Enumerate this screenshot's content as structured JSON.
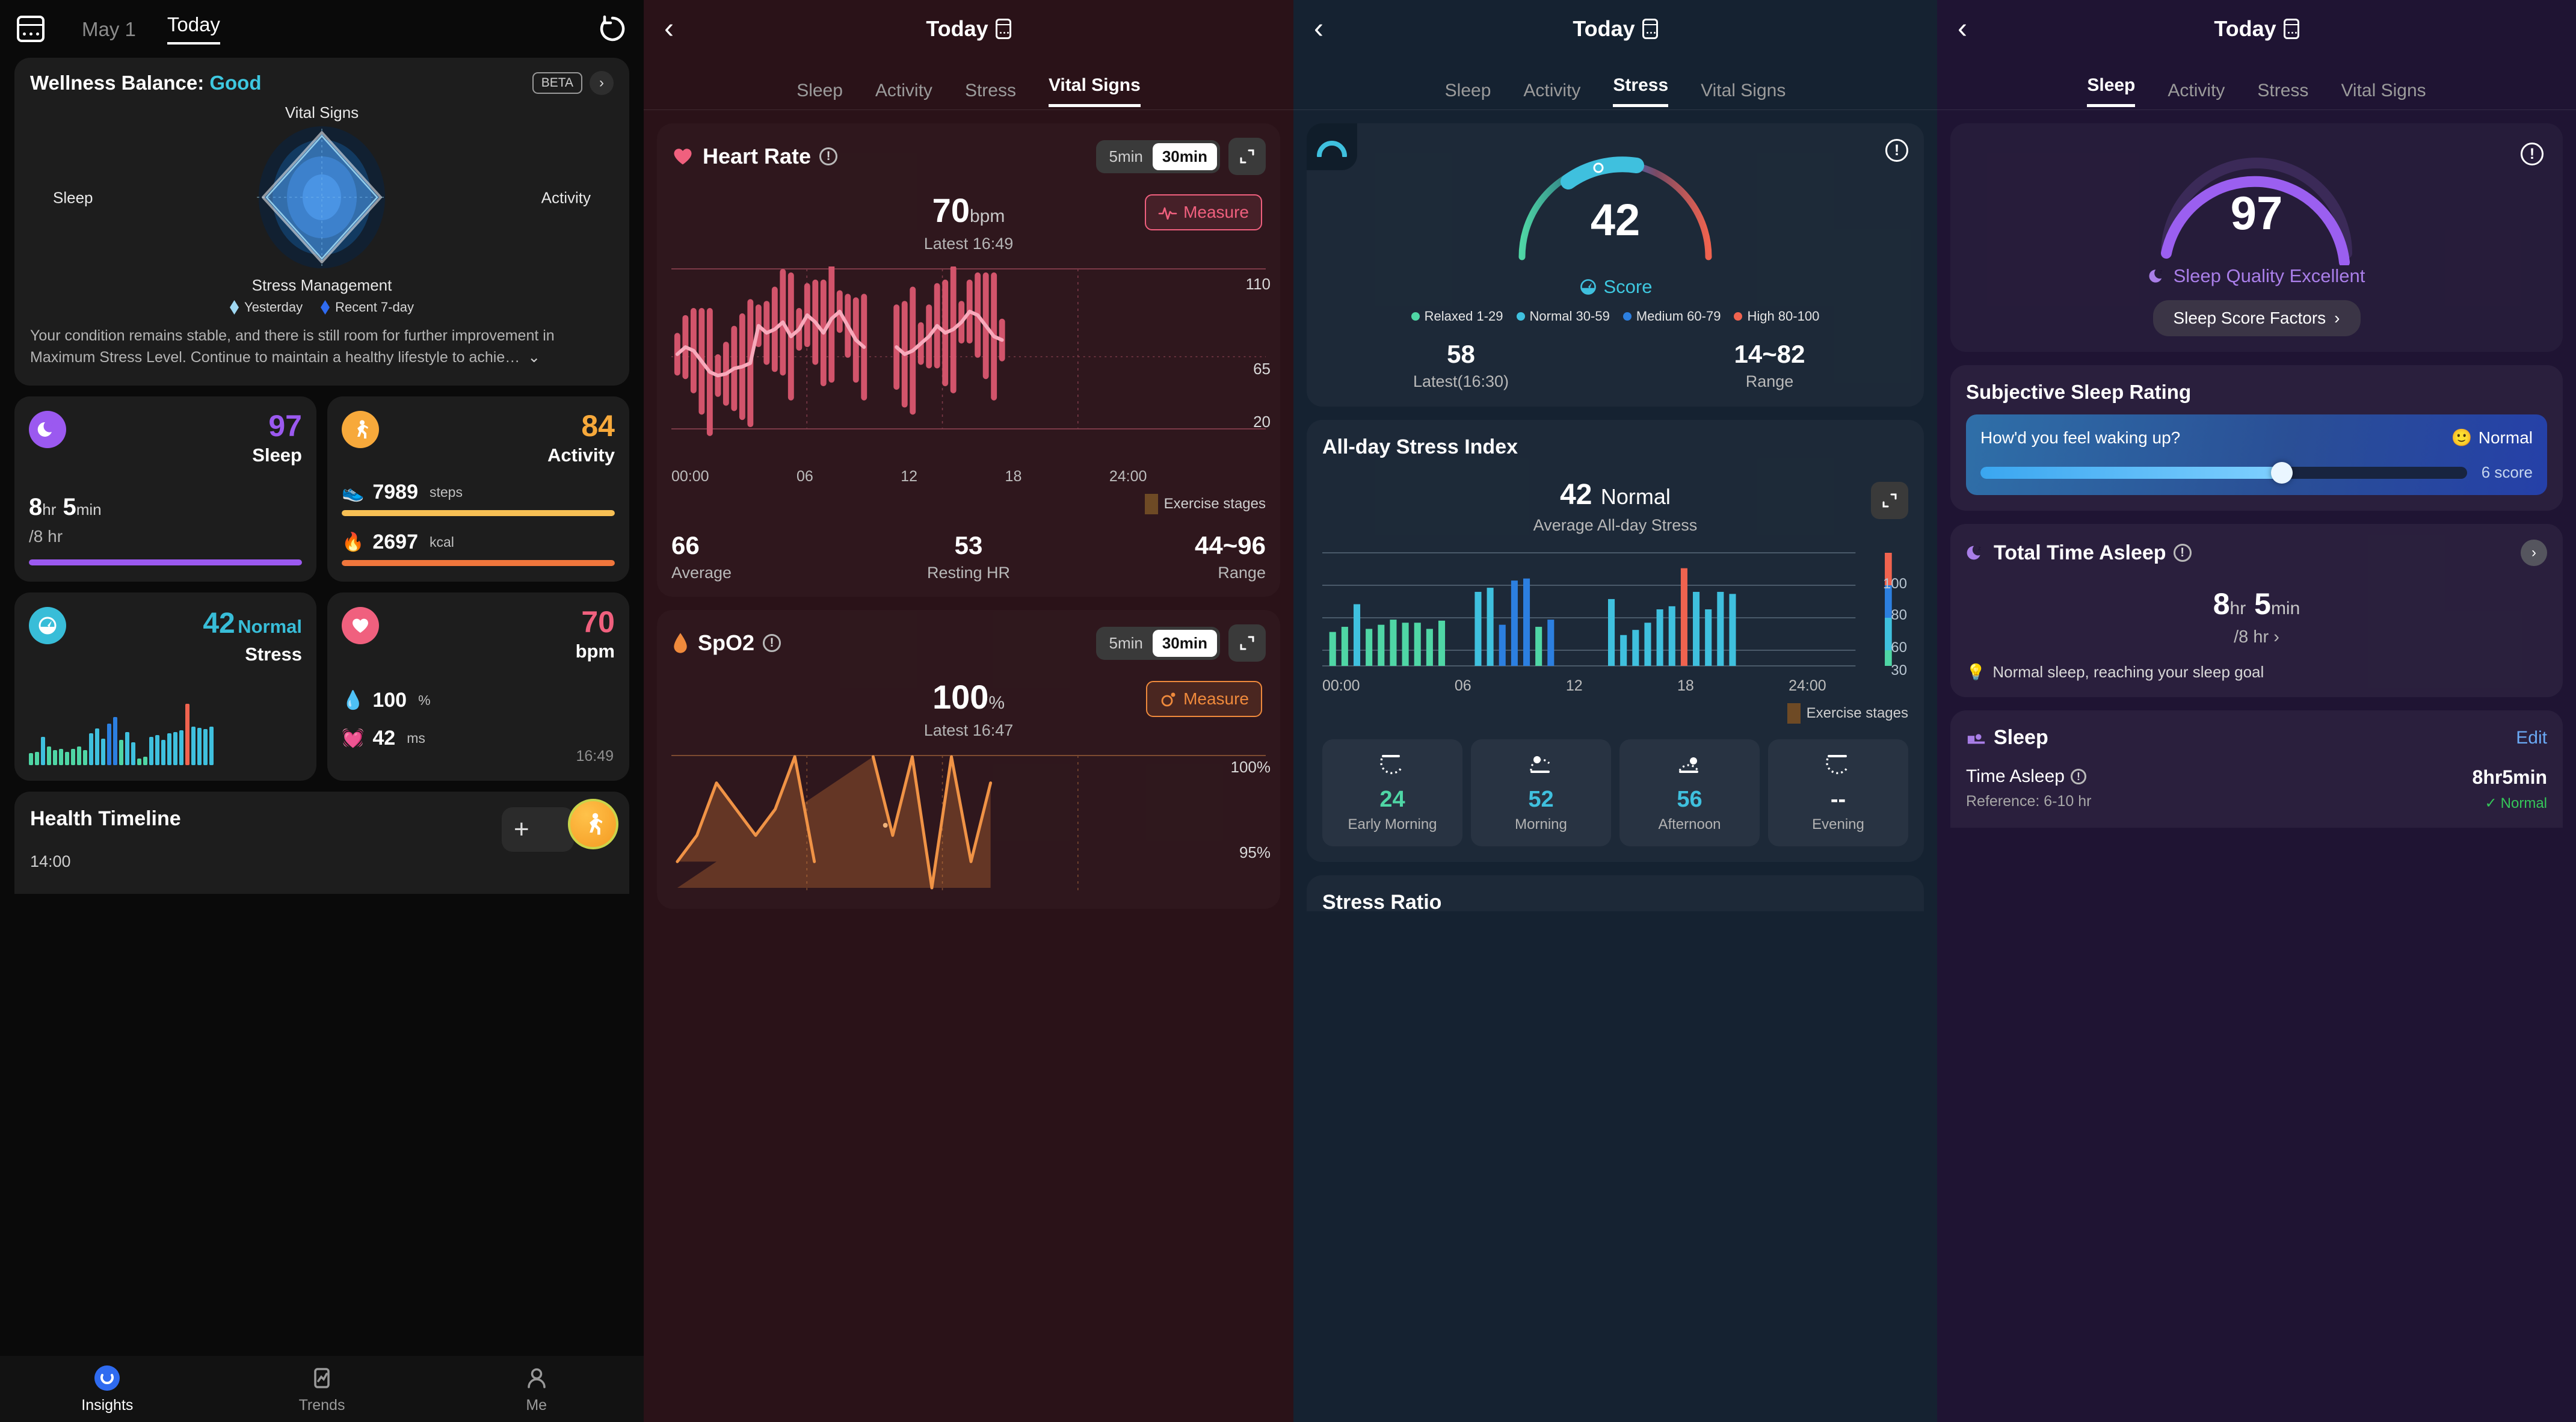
{
  "insights": {
    "header": {
      "calendar_icon": "calendar-icon",
      "date_prev": "May 1",
      "date_today": "Today",
      "refresh_icon": "refresh-icon"
    },
    "wellness": {
      "title_prefix": "Wellness Balance:",
      "status": "Good",
      "beta_badge": "BETA",
      "chevron": "›",
      "axes": {
        "top": "Vital Signs",
        "right": "Activity",
        "bottom": "Stress Management",
        "left": "Sleep"
      },
      "legend": [
        {
          "label": "Yesterday",
          "color": "#9fd8f2"
        },
        {
          "label": "Recent 7-day",
          "color": "#2f6bf0"
        }
      ],
      "description": "Your condition remains stable, and there is still room for further improvement in Maximum Stress Level. Continue to maintain a healthy lifestyle to achie…"
    },
    "cards": {
      "sleep": {
        "icon": "sleep-moon-icon",
        "score": "97",
        "label": "Sleep",
        "duration_h": "8",
        "unit_h": "hr",
        "duration_m": "5",
        "unit_m": "min",
        "goal": "/8 hr",
        "color": "#9b59f0",
        "progress": 100
      },
      "activity": {
        "icon": "running-icon",
        "score": "84",
        "label": "Activity",
        "color": "#f7a93b",
        "steps_value": "7989",
        "steps_unit": "steps",
        "steps_progress": 100,
        "kcal_value": "2697",
        "kcal_unit": "kcal",
        "kcal_progress": 100,
        "steps_icon": "shoe-icon",
        "kcal_icon": "flame-icon"
      },
      "stress": {
        "icon": "stress-gauge-icon",
        "score": "42",
        "status": "Normal",
        "label": "Stress",
        "color": "#38bdd8"
      },
      "heartrate": {
        "icon": "heart-icon",
        "value": "70",
        "unit": "bpm",
        "color": "#f0607e",
        "spo2_value": "100",
        "spo2_unit": "%",
        "spo2_icon": "drop-icon",
        "hrv_value": "42",
        "hrv_unit": "ms",
        "hrv_icon": "heart-pulse-icon",
        "time": "16:49"
      }
    },
    "timeline": {
      "title": "Health Timeline",
      "time": "14:00",
      "add_icon": "plus-icon",
      "fab_icon": "running-fab-icon"
    },
    "tabbar": [
      {
        "label": "Insights",
        "icon": "insights-ring-icon",
        "active": true
      },
      {
        "label": "Trends",
        "icon": "trends-chart-icon",
        "active": false
      },
      {
        "label": "Me",
        "icon": "person-icon",
        "active": false
      }
    ]
  },
  "vitalsigns": {
    "header": {
      "back": "‹",
      "title": "Today",
      "phone_icon": "phone-icon"
    },
    "tabs": [
      "Sleep",
      "Activity",
      "Stress",
      "Vital Signs"
    ],
    "active_tab": "Vital Signs",
    "heart_rate": {
      "title": "Heart Rate",
      "info_icon": "info-icon",
      "seg": [
        "5min",
        "30min"
      ],
      "seg_active": "30min",
      "expand_icon": "expand-icon",
      "value": "70",
      "unit": "bpm",
      "latest": "Latest 16:49",
      "measure_label": "Measure",
      "measure_icon": "ecg-icon",
      "legend": "Exercise stages",
      "stats": [
        {
          "value": "66",
          "label": "Average"
        },
        {
          "value": "53",
          "label": "Resting HR"
        },
        {
          "value": "44~96",
          "label": "Range"
        }
      ]
    },
    "spo2": {
      "title": "SpO2",
      "info_icon": "info-icon",
      "seg": [
        "5min",
        "30min"
      ],
      "seg_active": "30min",
      "expand_icon": "expand-icon",
      "value": "100",
      "unit": "%",
      "latest": "Latest 16:47",
      "measure_label": "Measure",
      "measure_icon": "spo2-icon"
    }
  },
  "stress": {
    "header": {
      "back": "‹",
      "title": "Today",
      "phone_icon": "phone-icon"
    },
    "tabs": [
      "Sleep",
      "Activity",
      "Stress",
      "Vital Signs"
    ],
    "active_tab": "Stress",
    "gauge": {
      "score": "42",
      "score_label": "Score",
      "score_icon": "stress-gauge-icon",
      "warn_icon": "info-icon",
      "corner_icon": "arc-icon",
      "legend": [
        {
          "label": "Relaxed 1-29",
          "color": "#4fd6a5"
        },
        {
          "label": "Normal 30-59",
          "color": "#3fc0de"
        },
        {
          "label": "Medium 60-79",
          "color": "#2c7fe0"
        },
        {
          "label": "High 80-100",
          "color": "#f0634f"
        }
      ],
      "stats": [
        {
          "value": "58",
          "label": "Latest(16:30)"
        },
        {
          "value": "14~82",
          "label": "Range"
        }
      ]
    },
    "allday": {
      "title": "All-day Stress Index",
      "avg_value": "42",
      "avg_status": "Normal",
      "avg_label": "Average All-day Stress",
      "expand_icon": "expand-icon",
      "legend": "Exercise stages"
    },
    "time_of_day": [
      {
        "icon": "early-morning-icon",
        "value": "24",
        "label": "Early Morning",
        "color": "#4fd6a5"
      },
      {
        "icon": "morning-icon",
        "value": "52",
        "label": "Morning",
        "color": "#3fc0de"
      },
      {
        "icon": "afternoon-icon",
        "value": "56",
        "label": "Afternoon",
        "color": "#3fc0de"
      },
      {
        "icon": "evening-icon",
        "value": "--",
        "label": "Evening",
        "color": "#ffffff"
      }
    ],
    "next_section_title": "Stress Ratio"
  },
  "sleep": {
    "header": {
      "back": "‹",
      "title": "Today",
      "phone_icon": "phone-icon"
    },
    "tabs": [
      "Sleep",
      "Activity",
      "Stress",
      "Vital Signs"
    ],
    "active_tab": "Sleep",
    "score": {
      "value": "97",
      "quality_label": "Sleep Quality Excellent",
      "quality_icon": "sleep-moon-icon",
      "warn_icon": "info-icon",
      "factors_button": "Sleep Score Factors",
      "factors_chevron": "›"
    },
    "subjective": {
      "title": "Subjective Sleep Rating",
      "question": "How'd you feel waking up?",
      "mood_emoji": "🙂",
      "mood_label": "Normal",
      "score_text": "6 score",
      "slider_percent": 62
    },
    "total_time": {
      "title": "Total Time Asleep",
      "info_icon": "info-icon",
      "chevron": "›",
      "hours": "8",
      "hours_unit": "hr",
      "minutes": "5",
      "minutes_unit": "min",
      "goal": "/8 hr",
      "goal_chevron": "›",
      "note_icon": "bulb-icon",
      "note": "Normal sleep, reaching your sleep goal"
    },
    "sleep_section": {
      "title": "Sleep",
      "icon": "sleep-bed-icon",
      "edit": "Edit",
      "row_key": "Time Asleep",
      "row_info_icon": "info-icon",
      "row_value": "8hr5min",
      "row_ref": "Reference: 6-10 hr",
      "row_badge": "Normal",
      "row_badge_icon": "check-icon"
    }
  },
  "chart_data": [
    {
      "type": "line",
      "title": "Heart Rate",
      "xlabel": "",
      "ylabel": "bpm",
      "ylim": [
        20,
        110
      ],
      "yticks": [
        110,
        65,
        20
      ],
      "xticks": [
        "00:00",
        "06",
        "12",
        "18",
        "24:00"
      ],
      "series": [
        {
          "name": "Heart Rate",
          "values": [
            62,
            66,
            64,
            58,
            52,
            50,
            51,
            54,
            55,
            57,
            78,
            74,
            76,
            80,
            72,
            76,
            84,
            80,
            74,
            82,
            86,
            78,
            70,
            66,
            null,
            null,
            null,
            66,
            62,
            64,
            68,
            72,
            78,
            74,
            76,
            80,
            86,
            84,
            78,
            72,
            70
          ]
        }
      ],
      "range_band": {
        "low": 44,
        "high": 96
      }
    },
    {
      "type": "line",
      "title": "SpO2",
      "xlabel": "",
      "ylabel": "%",
      "ylim": [
        95,
        100
      ],
      "yticks": [
        "100%",
        "95%"
      ],
      "series": [
        {
          "name": "SpO2",
          "values": [
            96,
            97,
            99,
            98,
            97,
            98,
            100,
            96,
            null,
            null,
            100,
            97,
            100,
            95,
            100,
            96,
            99
          ]
        }
      ]
    },
    {
      "type": "bar",
      "title": "All-day Stress Index",
      "xlabel": "",
      "ylabel": "Stress",
      "ylim": [
        0,
        110
      ],
      "yticks": [
        100,
        80,
        60,
        30
      ],
      "xticks": [
        "00:00",
        "06",
        "12",
        "18",
        "24:00"
      ],
      "categories": [
        "00:00",
        "",
        "",
        "",
        "",
        "",
        "",
        "06",
        "",
        "",
        "",
        "",
        "12",
        "",
        "",
        "",
        "",
        "18",
        "",
        "",
        "24:00"
      ],
      "values": [
        33,
        38,
        60,
        36,
        40,
        45,
        42,
        42,
        36,
        44,
        0,
        0,
        72,
        76,
        40,
        83,
        85,
        38,
        45,
        0,
        0,
        0,
        0,
        65,
        30,
        35,
        42,
        55,
        58,
        95,
        72,
        55,
        72,
        70,
        0,
        0,
        0,
        0,
        0,
        0,
        0,
        0
      ],
      "colors": [
        "#4fd6a5",
        "#4fd6a5",
        "#3fc0de",
        "#4fd6a5",
        "#4fd6a5",
        "#4fd6a5",
        "#4fd6a5",
        "#4fd6a5",
        "#4fd6a5",
        "#4fd6a5",
        "",
        "",
        "#3fc0de",
        "#3fc0de",
        "#2c7fe0",
        "#2c7fe0",
        "#2c7fe0",
        "#4fd6a5",
        "#2c7fe0",
        "",
        "",
        "",
        "",
        "#3fc0de",
        "#3fc0de",
        "#3fc0de",
        "#3fc0de",
        "#3fc0de",
        "#3fc0de",
        "#f0634f",
        "#3fc0de",
        "#3fc0de",
        "#3fc0de",
        "#3fc0de"
      ]
    },
    {
      "type": "bar",
      "title": "Stress sparkline",
      "ylim": [
        0,
        100
      ],
      "values": [
        18,
        20,
        42,
        28,
        22,
        24,
        20,
        24,
        28,
        22,
        48,
        55,
        40,
        62,
        72,
        38,
        50,
        34,
        10,
        12,
        42,
        45,
        38,
        48,
        50,
        52,
        92,
        58,
        56,
        54,
        58
      ],
      "colors": [
        "#4fd6a5",
        "#4fd6a5",
        "#3fc0de",
        "#4fd6a5",
        "#4fd6a5",
        "#4fd6a5",
        "#4fd6a5",
        "#4fd6a5",
        "#4fd6a5",
        "#4fd6a5",
        "#3fc0de",
        "#3fc0de",
        "#3fc0de",
        "#2c7fe0",
        "#2c7fe0",
        "#4fd6a5",
        "#3fc0de",
        "#3fc0de",
        "#4fd6a5",
        "#4fd6a5",
        "#3fc0de",
        "#3fc0de",
        "#3fc0de",
        "#3fc0de",
        "#3fc0de",
        "#3fc0de",
        "#f0634f",
        "#3fc0de",
        "#3fc0de",
        "#3fc0de",
        "#3fc0de"
      ]
    }
  ]
}
